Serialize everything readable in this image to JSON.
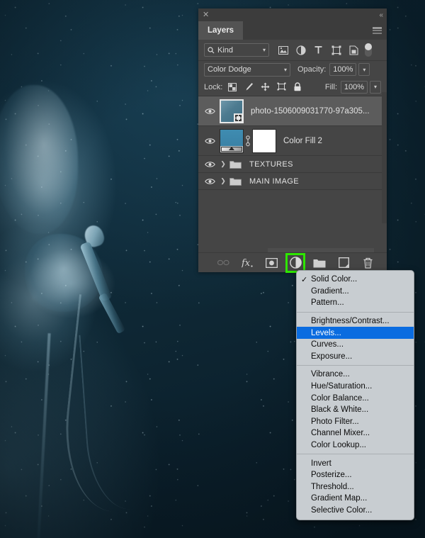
{
  "panel": {
    "titlebar": {
      "close": "✕",
      "collapse": "«"
    },
    "tab": "Layers",
    "filter": {
      "kind_label": "Kind",
      "search_icon": "magnifier-icon",
      "icons": [
        "pixel-filter-icon",
        "adjustment-filter-icon",
        "type-filter-icon",
        "shape-filter-icon",
        "smartobject-filter-icon"
      ],
      "toggle": "filter-enable-toggle"
    },
    "blend": {
      "mode": "Color Dodge",
      "opacity_label": "Opacity:",
      "opacity_value": "100%"
    },
    "lock": {
      "label": "Lock:",
      "icons": [
        "lock-transparent-pixels-icon",
        "lock-image-pixels-icon",
        "lock-position-icon",
        "lock-artboard-icon",
        "lock-all-icon"
      ],
      "fill_label": "Fill:",
      "fill_value": "100%"
    },
    "layers": [
      {
        "name": "photo-1506009031770-97a305...",
        "type": "smart-object",
        "visible": true,
        "selected": true
      },
      {
        "name": "Color Fill 2",
        "type": "fill-layer",
        "visible": true,
        "selected": false
      },
      {
        "name": "TEXTURES",
        "type": "group",
        "visible": true,
        "selected": false
      },
      {
        "name": "MAIN IMAGE",
        "type": "group",
        "visible": true,
        "selected": false
      }
    ],
    "bottom_buttons": [
      {
        "name": "link-layers-button",
        "glyph": "⚭",
        "disabled": true
      },
      {
        "name": "layer-style-button",
        "glyph": "fx",
        "disabled": false
      },
      {
        "name": "add-layer-mask-button",
        "glyph": "mask",
        "disabled": false
      },
      {
        "name": "new-adjustment-layer-button",
        "glyph": "half-circle",
        "disabled": false,
        "highlighted": true
      },
      {
        "name": "new-group-button",
        "glyph": "folder",
        "disabled": false
      },
      {
        "name": "new-layer-button",
        "glyph": "page",
        "disabled": false
      },
      {
        "name": "delete-layer-button",
        "glyph": "trash",
        "disabled": false
      }
    ]
  },
  "context_menu": {
    "groups": [
      [
        {
          "label": "Solid Color...",
          "checked": true
        },
        {
          "label": "Gradient...",
          "checked": false
        },
        {
          "label": "Pattern...",
          "checked": false
        }
      ],
      [
        {
          "label": "Brightness/Contrast...",
          "checked": false
        },
        {
          "label": "Levels...",
          "checked": false,
          "selected": true
        },
        {
          "label": "Curves...",
          "checked": false
        },
        {
          "label": "Exposure...",
          "checked": false
        }
      ],
      [
        {
          "label": "Vibrance...",
          "checked": false
        },
        {
          "label": "Hue/Saturation...",
          "checked": false
        },
        {
          "label": "Color Balance...",
          "checked": false
        },
        {
          "label": "Black & White...",
          "checked": false
        },
        {
          "label": "Photo Filter...",
          "checked": false
        },
        {
          "label": "Channel Mixer...",
          "checked": false
        },
        {
          "label": "Color Lookup...",
          "checked": false
        }
      ],
      [
        {
          "label": "Invert",
          "checked": false
        },
        {
          "label": "Posterize...",
          "checked": false
        },
        {
          "label": "Threshold...",
          "checked": false
        },
        {
          "label": "Gradient Map...",
          "checked": false
        },
        {
          "label": "Selective Color...",
          "checked": false
        }
      ]
    ]
  },
  "colors": {
    "panel_bg": "#454545",
    "panel_tab_bg": "#3c3c3c",
    "selected_layer": "#5c5c5c",
    "menu_bg": "#c8cdd1",
    "menu_highlight": "#0a6ce0",
    "highlight_box": "#2ee600",
    "photo_tone": "#0e2734"
  }
}
